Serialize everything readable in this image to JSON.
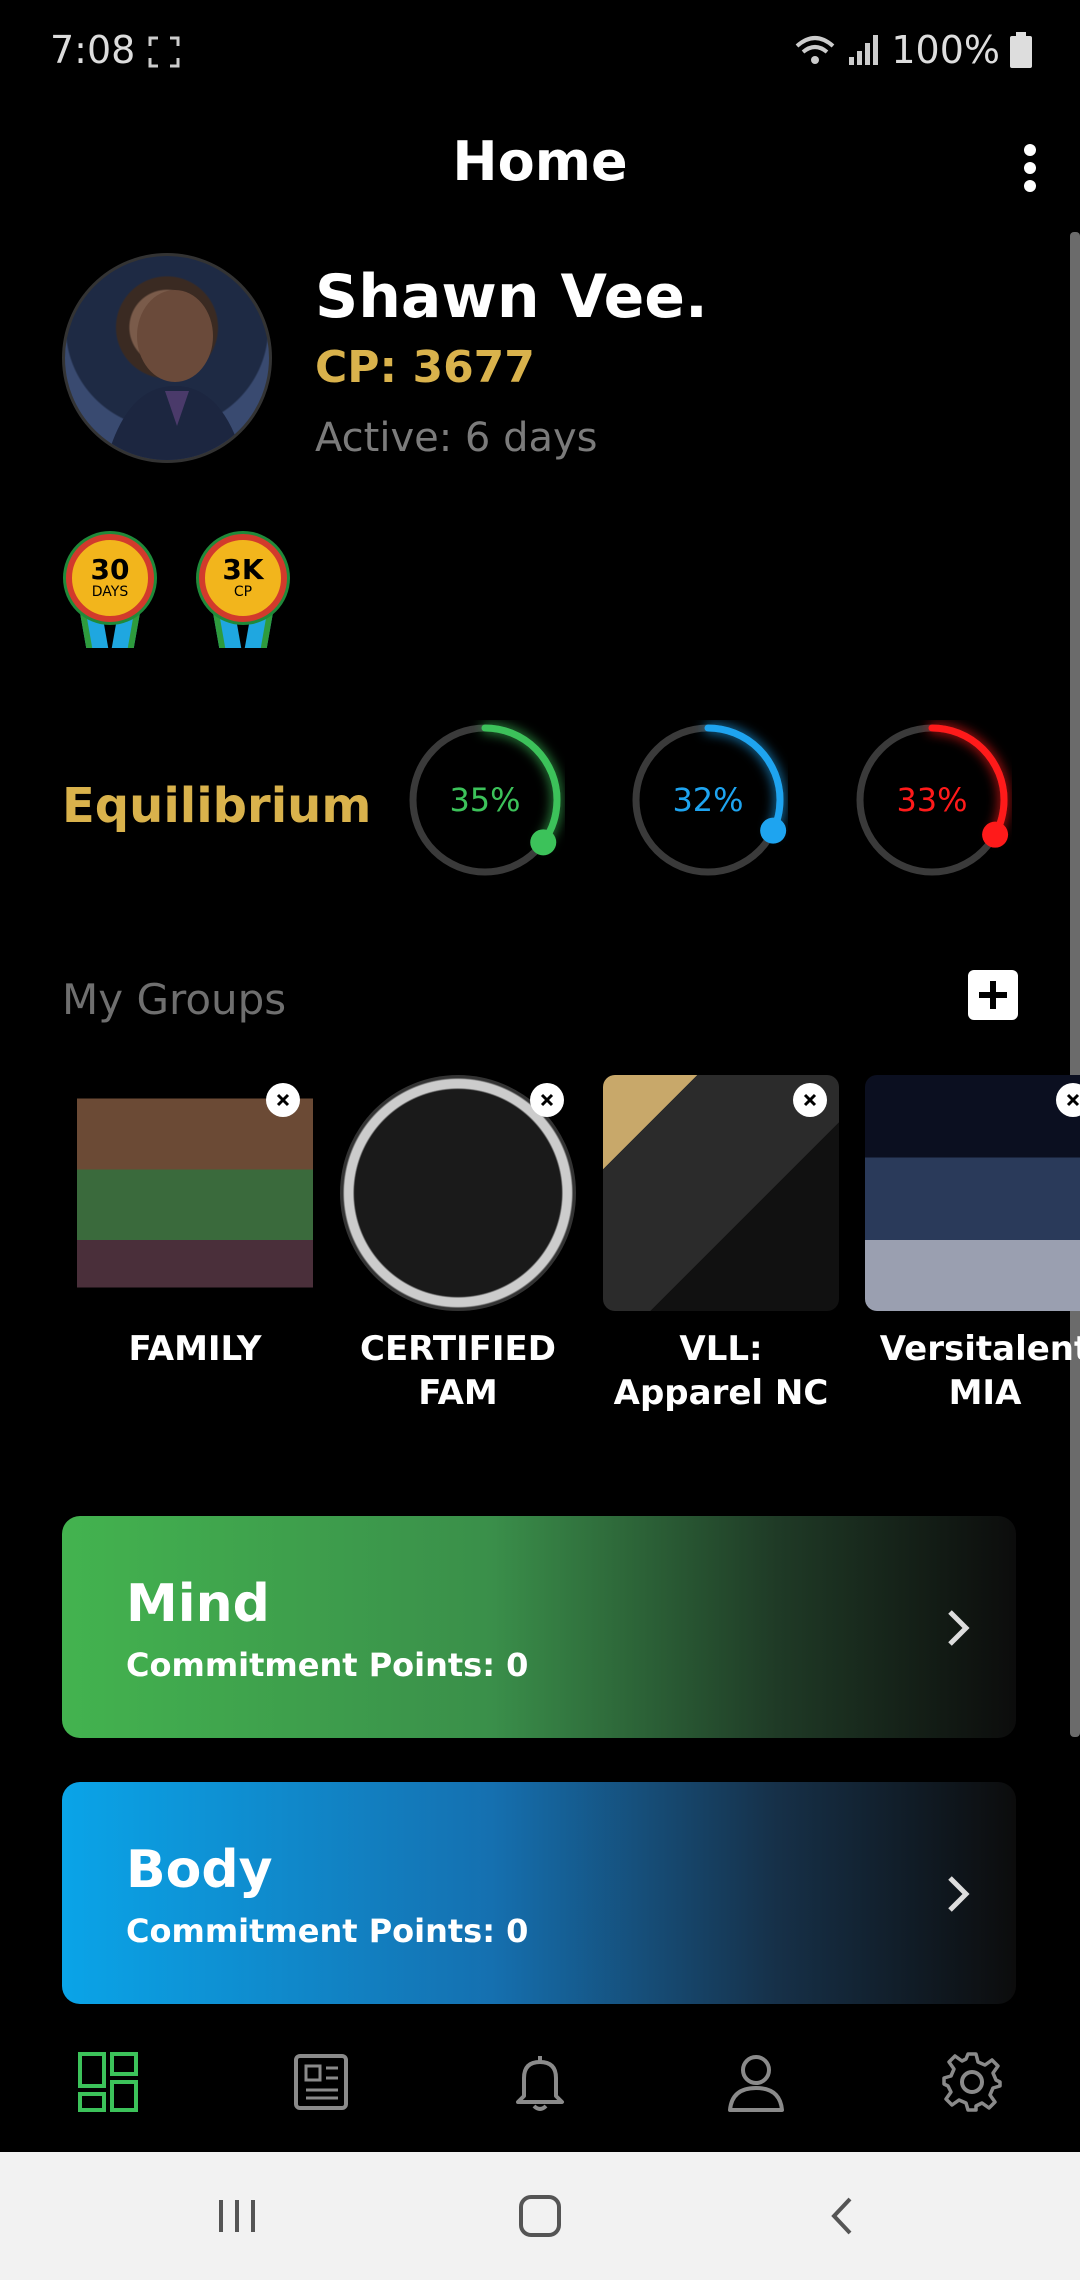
{
  "status_bar": {
    "time": "7:08",
    "battery": "100%"
  },
  "header": {
    "title": "Home"
  },
  "profile": {
    "name": "Shawn Vee.",
    "cp": "CP: 3677",
    "active": "Active: 6 days"
  },
  "badges": [
    {
      "big": "30",
      "small": "DAYS"
    },
    {
      "big": "3K",
      "small": "CP"
    }
  ],
  "equilibrium": {
    "label": "Equilibrium",
    "rings": [
      {
        "value": "35%",
        "fraction": 0.35,
        "color": "#3cc25a"
      },
      {
        "value": "32%",
        "fraction": 0.32,
        "color": "#1ea4f0"
      },
      {
        "value": "33%",
        "fraction": 0.33,
        "color": "#ff1a1a"
      }
    ]
  },
  "groups": {
    "title": "My Groups",
    "items": [
      {
        "label": "FAMILY"
      },
      {
        "label": "CERTIFIED FAM"
      },
      {
        "label": "VLL: Apparel NC"
      },
      {
        "label": "Versitalent MIA"
      }
    ]
  },
  "categories": [
    {
      "title": "Mind",
      "points": "Commitment Points: 0"
    },
    {
      "title": "Body",
      "points": "Commitment Points: 0"
    }
  ],
  "colors": {
    "accent_gold": "#d9b24c",
    "nav_active": "#3cc25a",
    "nav_inactive": "#8a8a8a"
  },
  "bottom_nav": [
    "dashboard-icon",
    "news-icon",
    "bell-icon",
    "profile-icon",
    "gear-icon"
  ]
}
